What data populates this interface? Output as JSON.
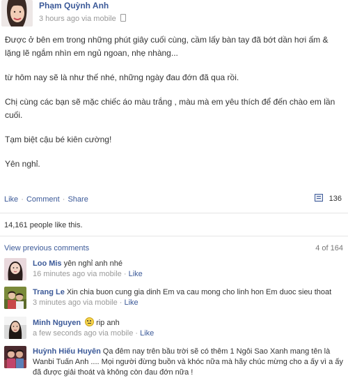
{
  "post": {
    "author": "Phạm Quỳnh Anh",
    "time": "3 hours ago",
    "via": "via mobile",
    "paragraphs": [
      "Được ở bên em trong những phút giây cuối cùng, cầm lấy bàn tay đã bớt dần hơi ấm & lặng lẽ ngắm nhìn em ngủ ngoan, nhẹ nhàng...",
      "từ hôm nay sẽ là như thế nhé, những ngày đau đớn đã qua rồi.",
      "Chị cùng các bạn sẽ mặc chiếc áo màu trắng , màu mà em yêu thích để đến chào em lần cuối.",
      "Tạm biệt cậu bé kiên cường!",
      "Yên nghỉ."
    ]
  },
  "actions": {
    "like": "Like",
    "comment": "Comment",
    "share": "Share",
    "comment_count": "136"
  },
  "likes_text": "14,161 people like this.",
  "view_previous": {
    "label": "View previous comments",
    "count": "4 of 164"
  },
  "comments": [
    {
      "author": "Loo Mis",
      "text": "yên nghỉ anh nhé",
      "time": "16 minutes ago",
      "via": "via mobile",
      "like": "Like"
    },
    {
      "author": "Trang Le",
      "text": "Xin chia buon cung gia dinh Em va cau mong cho linh hon Em duoc sieu thoat",
      "time": "3 minutes ago",
      "via": "via mobile",
      "like": "Like"
    },
    {
      "author": "Minh Nguyen",
      "text": "rip anh",
      "time": "a few seconds ago",
      "via": "via mobile",
      "like": "Like"
    },
    {
      "author": "Huỳnh Hiếu Huyên",
      "text": "Qa đêm nay trên bầu trời sẽ có thêm 1 Ngôi Sao Xanh mang tên là Wanbi Tuấn Anh .... Mọi người đừng buồn và khóc nữa mà hãy chúc mừng cho a ấy vì a ấy đã được giải thoát và không còn đau đớn nữa !"
    }
  ],
  "colors": {
    "link": "#3b5998",
    "meta": "#999999",
    "text": "#333333"
  },
  "icons": {
    "mobile": "mobile-phone-icon",
    "comments": "comment-bubble-icon",
    "emoticon": "smiley-emoji-icon"
  }
}
